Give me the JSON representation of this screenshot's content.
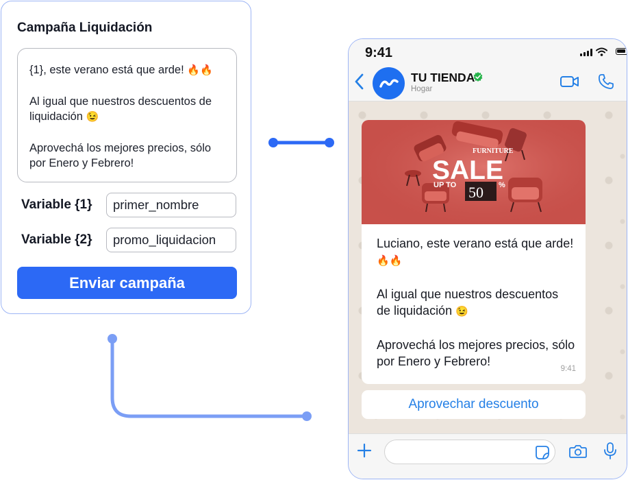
{
  "campaign": {
    "title": "Campaña Liquidación",
    "template_line1": "{1}, este verano está que arde!",
    "template_line1_emoji": "🔥🔥",
    "template_line2": "Al igual que nuestros descuentos de liquidación",
    "template_line2_emoji": "😉",
    "template_line3": "Aprovechá los mejores precios, sólo por Enero y Febrero!",
    "variable1_label": "Variable {1}",
    "variable1_value": "primer_nombre",
    "variable2_label": "Variable {2}",
    "variable2_value": "promo_liquidacion",
    "send_button": "Enviar campaña"
  },
  "phone": {
    "time": "9:41",
    "contact_name": "TU TIENDA",
    "contact_subtitle": "Hogar",
    "promo": {
      "tag": "FURNITURE",
      "headline": "SALE",
      "upto": "UP TO",
      "percent": "50",
      "percent_sign": "%"
    },
    "message_line1": "Luciano, este verano está que arde!",
    "message_line1_emoji": "🔥🔥",
    "message_line2": "Al igual que nuestros descuentos de liquidación",
    "message_line2_emoji": "😉",
    "message_line3": "Aprovechá los mejores precios, sólo por Enero y Febrero!",
    "message_time": "9:41",
    "cta_button": "Aprovechar descuento"
  },
  "colors": {
    "accent": "#2c69f5",
    "card_border": "#9db5f5",
    "connector": "#7b9ef5",
    "link": "#2580e6",
    "promo_background": "#c8504a",
    "verified": "#25b34a"
  },
  "icons": [
    "back-icon",
    "verified-icon",
    "video-icon",
    "phone-call-icon",
    "plus-icon",
    "sticker-icon",
    "camera-icon",
    "mic-icon",
    "signal-icon",
    "wifi-icon",
    "battery-icon",
    "messenger-logo-icon"
  ]
}
